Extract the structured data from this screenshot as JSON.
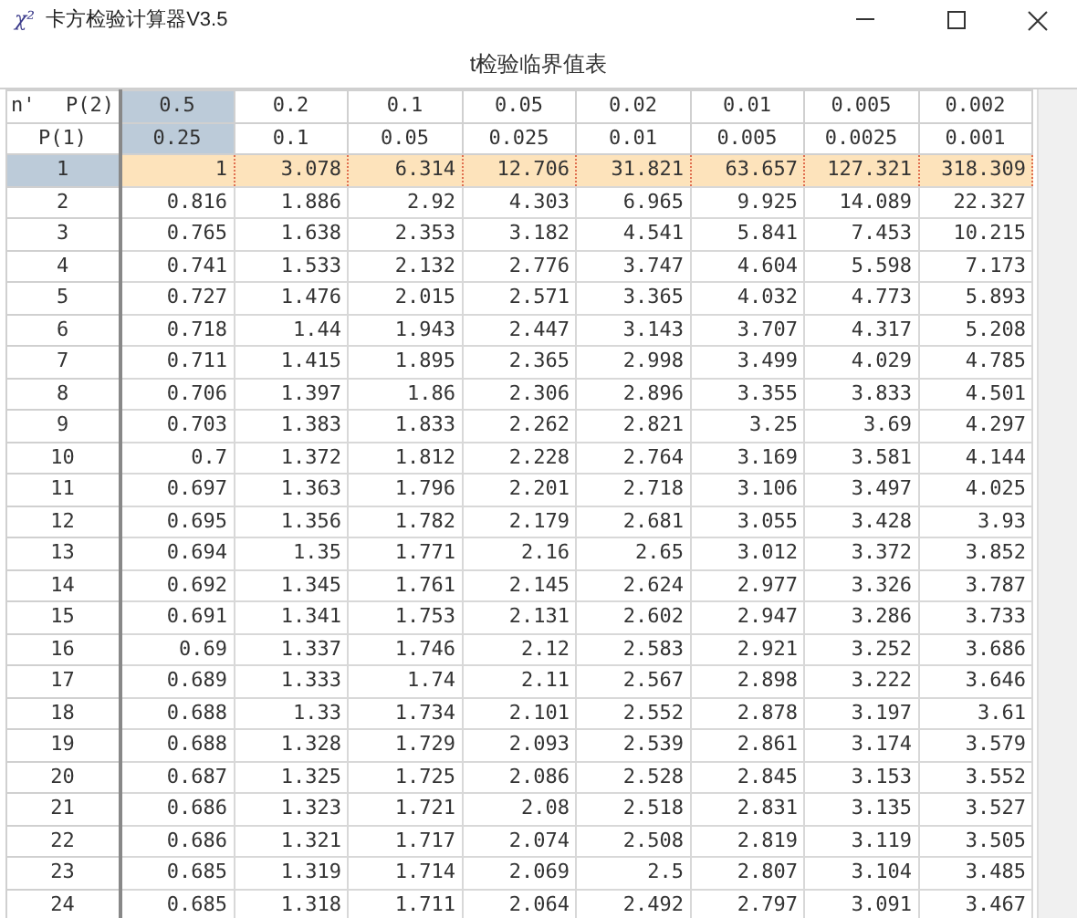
{
  "window": {
    "icon": "χ²",
    "title": "卡方检验计算器V3.5"
  },
  "table_title": "t检验临界值表",
  "corner": {
    "top_left": "n'",
    "p2_label": "P(2)",
    "p1_label": "P(1)"
  },
  "columns": [
    {
      "p2": "0.5",
      "p1": "0.25",
      "selected": true
    },
    {
      "p2": "0.2",
      "p1": "0.1",
      "selected": false
    },
    {
      "p2": "0.1",
      "p1": "0.05",
      "selected": false
    },
    {
      "p2": "0.05",
      "p1": "0.025",
      "selected": false
    },
    {
      "p2": "0.02",
      "p1": "0.01",
      "selected": false
    },
    {
      "p2": "0.01",
      "p1": "0.005",
      "selected": false
    },
    {
      "p2": "0.005",
      "p1": "0.0025",
      "selected": false
    },
    {
      "p2": "0.002",
      "p1": "0.001",
      "selected": false
    }
  ],
  "rows": [
    {
      "n": "1",
      "values": [
        "1",
        "3.078",
        "6.314",
        "12.706",
        "31.821",
        "63.657",
        "127.321",
        "318.309"
      ],
      "selected": true
    },
    {
      "n": "2",
      "values": [
        "0.816",
        "1.886",
        "2.92",
        "4.303",
        "6.965",
        "9.925",
        "14.089",
        "22.327"
      ],
      "selected": false
    },
    {
      "n": "3",
      "values": [
        "0.765",
        "1.638",
        "2.353",
        "3.182",
        "4.541",
        "5.841",
        "7.453",
        "10.215"
      ],
      "selected": false
    },
    {
      "n": "4",
      "values": [
        "0.741",
        "1.533",
        "2.132",
        "2.776",
        "3.747",
        "4.604",
        "5.598",
        "7.173"
      ],
      "selected": false
    },
    {
      "n": "5",
      "values": [
        "0.727",
        "1.476",
        "2.015",
        "2.571",
        "3.365",
        "4.032",
        "4.773",
        "5.893"
      ],
      "selected": false
    },
    {
      "n": "6",
      "values": [
        "0.718",
        "1.44",
        "1.943",
        "2.447",
        "3.143",
        "3.707",
        "4.317",
        "5.208"
      ],
      "selected": false
    },
    {
      "n": "7",
      "values": [
        "0.711",
        "1.415",
        "1.895",
        "2.365",
        "2.998",
        "3.499",
        "4.029",
        "4.785"
      ],
      "selected": false
    },
    {
      "n": "8",
      "values": [
        "0.706",
        "1.397",
        "1.86",
        "2.306",
        "2.896",
        "3.355",
        "3.833",
        "4.501"
      ],
      "selected": false
    },
    {
      "n": "9",
      "values": [
        "0.703",
        "1.383",
        "1.833",
        "2.262",
        "2.821",
        "3.25",
        "3.69",
        "4.297"
      ],
      "selected": false
    },
    {
      "n": "10",
      "values": [
        "0.7",
        "1.372",
        "1.812",
        "2.228",
        "2.764",
        "3.169",
        "3.581",
        "4.144"
      ],
      "selected": false
    },
    {
      "n": "11",
      "values": [
        "0.697",
        "1.363",
        "1.796",
        "2.201",
        "2.718",
        "3.106",
        "3.497",
        "4.025"
      ],
      "selected": false
    },
    {
      "n": "12",
      "values": [
        "0.695",
        "1.356",
        "1.782",
        "2.179",
        "2.681",
        "3.055",
        "3.428",
        "3.93"
      ],
      "selected": false
    },
    {
      "n": "13",
      "values": [
        "0.694",
        "1.35",
        "1.771",
        "2.16",
        "2.65",
        "3.012",
        "3.372",
        "3.852"
      ],
      "selected": false
    },
    {
      "n": "14",
      "values": [
        "0.692",
        "1.345",
        "1.761",
        "2.145",
        "2.624",
        "2.977",
        "3.326",
        "3.787"
      ],
      "selected": false
    },
    {
      "n": "15",
      "values": [
        "0.691",
        "1.341",
        "1.753",
        "2.131",
        "2.602",
        "2.947",
        "3.286",
        "3.733"
      ],
      "selected": false
    },
    {
      "n": "16",
      "values": [
        "0.69",
        "1.337",
        "1.746",
        "2.12",
        "2.583",
        "2.921",
        "3.252",
        "3.686"
      ],
      "selected": false
    },
    {
      "n": "17",
      "values": [
        "0.689",
        "1.333",
        "1.74",
        "2.11",
        "2.567",
        "2.898",
        "3.222",
        "3.646"
      ],
      "selected": false
    },
    {
      "n": "18",
      "values": [
        "0.688",
        "1.33",
        "1.734",
        "2.101",
        "2.552",
        "2.878",
        "3.197",
        "3.61"
      ],
      "selected": false
    },
    {
      "n": "19",
      "values": [
        "0.688",
        "1.328",
        "1.729",
        "2.093",
        "2.539",
        "2.861",
        "3.174",
        "3.579"
      ],
      "selected": false
    },
    {
      "n": "20",
      "values": [
        "0.687",
        "1.325",
        "1.725",
        "2.086",
        "2.528",
        "2.845",
        "3.153",
        "3.552"
      ],
      "selected": false
    },
    {
      "n": "21",
      "values": [
        "0.686",
        "1.323",
        "1.721",
        "2.08",
        "2.518",
        "2.831",
        "3.135",
        "3.527"
      ],
      "selected": false
    },
    {
      "n": "22",
      "values": [
        "0.686",
        "1.321",
        "1.717",
        "2.074",
        "2.508",
        "2.819",
        "3.119",
        "3.505"
      ],
      "selected": false
    },
    {
      "n": "23",
      "values": [
        "0.685",
        "1.319",
        "1.714",
        "2.069",
        "2.5",
        "2.807",
        "3.104",
        "3.485"
      ],
      "selected": false
    },
    {
      "n": "24",
      "values": [
        "0.685",
        "1.318",
        "1.711",
        "2.064",
        "2.492",
        "2.797",
        "3.091",
        "3.467"
      ],
      "selected": false
    }
  ]
}
